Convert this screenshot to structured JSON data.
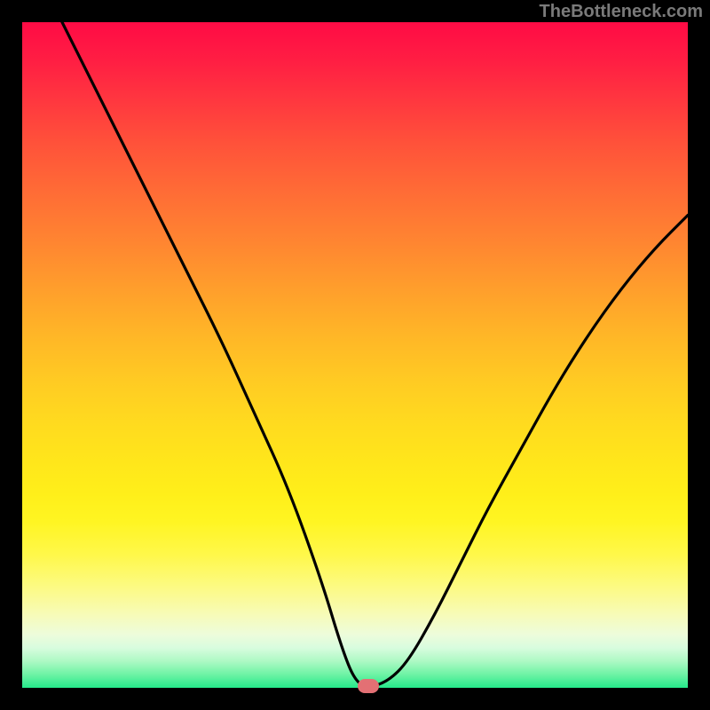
{
  "attribution": "TheBottleneck.com",
  "chart_data": {
    "type": "line",
    "title": "",
    "xlabel": "",
    "ylabel": "",
    "xlim": [
      0,
      100
    ],
    "ylim": [
      0,
      100
    ],
    "series": [
      {
        "name": "bottleneck-curve",
        "x": [
          6,
          10,
          15,
          20,
          25,
          30,
          35,
          40,
          45,
          48,
          50,
          52,
          55,
          58,
          62,
          66,
          70,
          75,
          80,
          85,
          90,
          95,
          100
        ],
        "values": [
          100,
          92,
          82,
          72,
          62,
          52,
          41,
          30,
          16,
          6,
          1,
          0,
          1,
          4,
          11,
          19,
          27,
          36,
          45,
          53,
          60,
          66,
          71
        ]
      }
    ],
    "marker": {
      "x": 52,
      "y": 0
    },
    "background_gradient": {
      "top": "#ff0b45",
      "bottom": "#25e98a"
    }
  }
}
